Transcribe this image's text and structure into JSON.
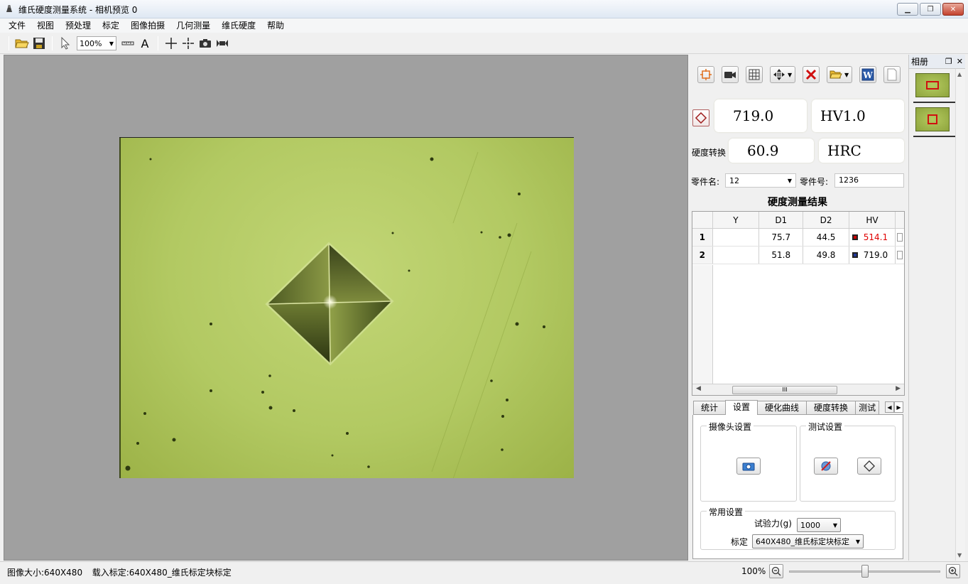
{
  "window": {
    "title": "维氏硬度测量系统 - 相机预览 0"
  },
  "menu": [
    "文件",
    "视图",
    "预处理",
    "标定",
    "图像拍摄",
    "几何测量",
    "维氏硬度",
    "帮助"
  ],
  "toolbar": {
    "zoom": "100%"
  },
  "measurement": {
    "hv_value": "719.0",
    "load_label": "HV1.0",
    "conversion_label": "硬度转换",
    "converted_value": "60.9",
    "converted_unit": "HRC"
  },
  "part": {
    "name_label": "零件名:",
    "name_value": "12",
    "number_label": "零件号:",
    "number_value": "1236"
  },
  "results": {
    "title": "硬度测量结果",
    "columns": [
      "Y",
      "D1",
      "D2",
      "HV"
    ],
    "rows": [
      {
        "idx": "1",
        "y": "",
        "d1": "75.7",
        "d2": "44.5",
        "hv": "514.1",
        "hv_color": "#e00000"
      },
      {
        "idx": "2",
        "y": "",
        "d1": "51.8",
        "d2": "49.8",
        "hv": "719.0",
        "hv_color": "#000000"
      }
    ],
    "scroll_thumb": "III"
  },
  "tabs": [
    "统计",
    "设置",
    "硬化曲线",
    "硬度转换",
    "测试"
  ],
  "settings": {
    "camera_group": "摄像头设置",
    "test_group": "测试设置",
    "common_group": "常用设置",
    "force_label": "试验力(g)",
    "force_value": "1000",
    "calib_label": "标定",
    "calib_value": "640X480_维氏标定块标定"
  },
  "album": {
    "title": "相册"
  },
  "status": {
    "image_size": "图像大小:640X480",
    "calibration": "载入标定:640X480_维氏标定块标定",
    "zoom": "100%",
    "zoom_level": 0.5
  }
}
